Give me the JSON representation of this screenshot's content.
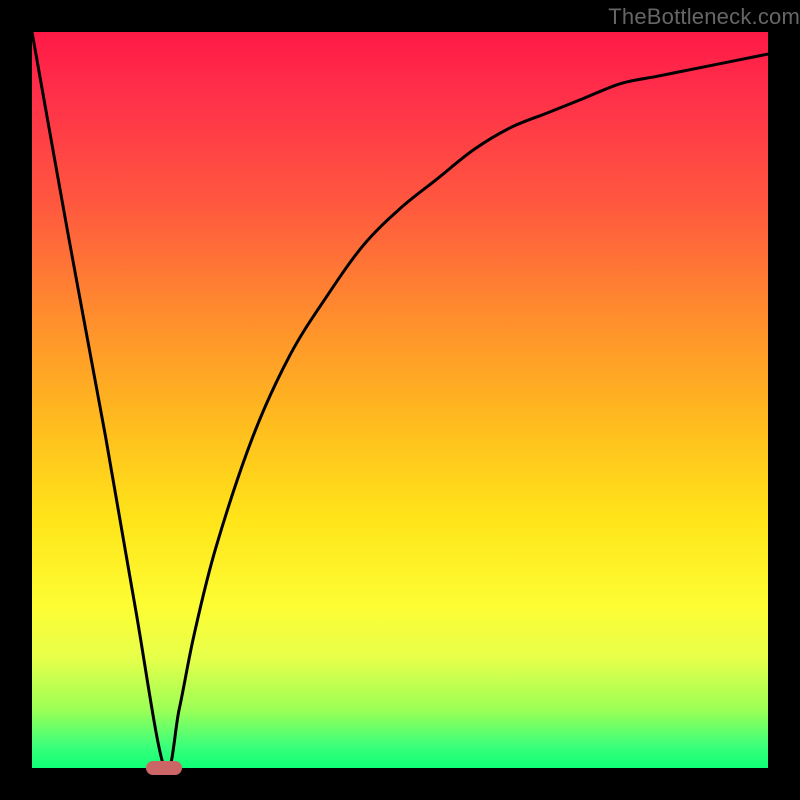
{
  "watermark": "TheBottleneck.com",
  "colors": {
    "frame": "#000000",
    "watermark": "#666666",
    "curve": "#000000",
    "marker": "#cc6666",
    "gradient_top": "#ff1a46",
    "gradient_mid1": "#ff8b2e",
    "gradient_mid2": "#ffe419",
    "gradient_bottom": "#0dff75"
  },
  "chart_data": {
    "type": "line",
    "title": "",
    "xlabel": "",
    "ylabel": "",
    "xlim": [
      0,
      100
    ],
    "ylim": [
      0,
      100
    ],
    "grid": false,
    "legend": false,
    "minimum_x": 18,
    "series": [
      {
        "name": "bottleneck-curve",
        "x": [
          0,
          5,
          10,
          14,
          18,
          20,
          22,
          25,
          30,
          35,
          40,
          45,
          50,
          55,
          60,
          65,
          70,
          75,
          80,
          85,
          90,
          95,
          100
        ],
        "y": [
          100,
          72,
          45,
          22,
          0,
          8,
          18,
          30,
          45,
          56,
          64,
          71,
          76,
          80,
          84,
          87,
          89,
          91,
          93,
          94,
          95,
          96,
          97
        ]
      }
    ],
    "annotations": [
      {
        "name": "min-marker",
        "x": 18,
        "y": 0,
        "shape": "pill",
        "color": "#cc6666"
      }
    ]
  }
}
